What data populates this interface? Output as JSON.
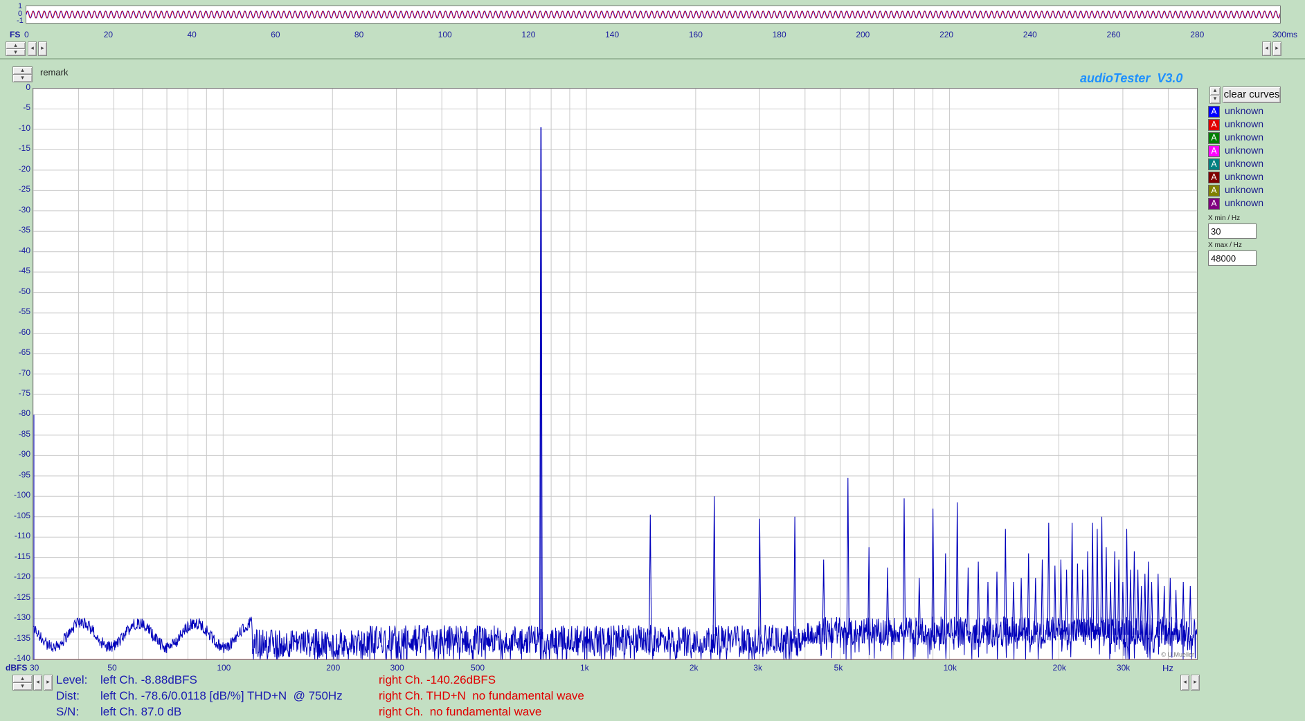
{
  "app": {
    "title": "audioTester  V3.0",
    "copyright": "© U.Mueller",
    "remark_label": "remark"
  },
  "waveform": {
    "y_labels": [
      "1",
      "0",
      "-1"
    ],
    "fs_label": "FS",
    "x_ticks": [
      "0",
      "20",
      "40",
      "60",
      "80",
      "100",
      "120",
      "140",
      "160",
      "180",
      "200",
      "220",
      "240",
      "260",
      "280",
      "300ms"
    ],
    "x_range_ms": [
      0,
      300
    ],
    "line_colors": [
      "#0000ff",
      "#e00000"
    ]
  },
  "spectrum": {
    "y_unit": "dBFS",
    "x_unit": "Hz",
    "y_ticks": [
      "0",
      "-5",
      "-10",
      "-15",
      "-20",
      "-25",
      "-30",
      "-35",
      "-40",
      "-45",
      "-50",
      "-55",
      "-60",
      "-65",
      "-70",
      "-75",
      "-80",
      "-85",
      "-90",
      "-95",
      "-100",
      "-105",
      "-110",
      "-115",
      "-120",
      "-125",
      "-130",
      "-135",
      "-140"
    ],
    "x_tick_labels": [
      {
        "f": 30,
        "t": "30"
      },
      {
        "f": 50,
        "t": "50"
      },
      {
        "f": 100,
        "t": "100"
      },
      {
        "f": 200,
        "t": "200"
      },
      {
        "f": 300,
        "t": "300"
      },
      {
        "f": 500,
        "t": "500"
      },
      {
        "f": 1000,
        "t": "1k"
      },
      {
        "f": 2000,
        "t": "2k"
      },
      {
        "f": 3000,
        "t": "3k"
      },
      {
        "f": 5000,
        "t": "5k"
      },
      {
        "f": 10000,
        "t": "10k"
      },
      {
        "f": 20000,
        "t": "20k"
      },
      {
        "f": 30000,
        "t": "30k"
      }
    ],
    "colors": {
      "left": "#0000bb",
      "right": "#e00000",
      "grid": "#c8c8c8"
    }
  },
  "chart_data": {
    "type": "line",
    "xscale": "log",
    "xlim": [
      30,
      48000
    ],
    "ylim": [
      -140,
      0
    ],
    "xlabel": "Hz",
    "ylabel": "dBFS",
    "series": [
      {
        "name": "left Ch.",
        "color": "#0000bb",
        "peaks": [
          {
            "x": 750,
            "y": -9.5
          },
          {
            "x": 1500,
            "y": -104.5
          },
          {
            "x": 2250,
            "y": -100
          },
          {
            "x": 3000,
            "y": -105.5
          },
          {
            "x": 3750,
            "y": -105
          },
          {
            "x": 4500,
            "y": -115.5
          },
          {
            "x": 5250,
            "y": -95.5
          },
          {
            "x": 6000,
            "y": -112.5
          },
          {
            "x": 6750,
            "y": -117.5
          },
          {
            "x": 7500,
            "y": -100.5
          },
          {
            "x": 8250,
            "y": -120
          },
          {
            "x": 9000,
            "y": -103
          },
          {
            "x": 9750,
            "y": -114
          },
          {
            "x": 10500,
            "y": -101.5
          },
          {
            "x": 11250,
            "y": -117.5
          },
          {
            "x": 12000,
            "y": -116
          },
          {
            "x": 12750,
            "y": -121
          },
          {
            "x": 13500,
            "y": -118.5
          },
          {
            "x": 14250,
            "y": -108
          },
          {
            "x": 15000,
            "y": -121
          },
          {
            "x": 15750,
            "y": -120
          },
          {
            "x": 16500,
            "y": -114
          },
          {
            "x": 17250,
            "y": -120
          },
          {
            "x": 18000,
            "y": -115.5
          },
          {
            "x": 18750,
            "y": -106.5
          },
          {
            "x": 19500,
            "y": -117
          },
          {
            "x": 20250,
            "y": -115.5
          },
          {
            "x": 21000,
            "y": -118
          },
          {
            "x": 21750,
            "y": -106.5
          },
          {
            "x": 22500,
            "y": -116.5
          },
          {
            "x": 23250,
            "y": -118
          },
          {
            "x": 24000,
            "y": -113.5
          },
          {
            "x": 24750,
            "y": -106.5
          },
          {
            "x": 25500,
            "y": -108
          },
          {
            "x": 26250,
            "y": -105
          },
          {
            "x": 27000,
            "y": -112.5
          },
          {
            "x": 27750,
            "y": -121
          },
          {
            "x": 28500,
            "y": -113.5
          },
          {
            "x": 29250,
            "y": -115.5
          },
          {
            "x": 30000,
            "y": -121
          },
          {
            "x": 30750,
            "y": -108
          },
          {
            "x": 31500,
            "y": -118
          },
          {
            "x": 32250,
            "y": -113.5
          },
          {
            "x": 33000,
            "y": -118
          },
          {
            "x": 33750,
            "y": -122
          },
          {
            "x": 34500,
            "y": -119
          },
          {
            "x": 35250,
            "y": -116
          },
          {
            "x": 36000,
            "y": -121
          },
          {
            "x": 37500,
            "y": -119
          },
          {
            "x": 39000,
            "y": -122
          },
          {
            "x": 40500,
            "y": -120
          },
          {
            "x": 42000,
            "y": -123
          },
          {
            "x": 44000,
            "y": -121
          },
          {
            "x": 46000,
            "y": -122
          }
        ],
        "noise_floor_dBFS": -135
      },
      {
        "name": "right Ch.",
        "color": "#e00000",
        "level_dBFS": -140.26
      }
    ]
  },
  "legend": {
    "clear_button": "clear curves",
    "items": [
      {
        "letter": "A",
        "label": "unknown",
        "color": "#0000ff"
      },
      {
        "letter": "A",
        "label": "unknown",
        "color": "#e00000"
      },
      {
        "letter": "A",
        "label": "unknown",
        "color": "#008000"
      },
      {
        "letter": "A",
        "label": "unknown",
        "color": "#ff00ff"
      },
      {
        "letter": "A",
        "label": "unknown",
        "color": "#008080"
      },
      {
        "letter": "A",
        "label": "unknown",
        "color": "#800000"
      },
      {
        "letter": "A",
        "label": "unknown",
        "color": "#808000"
      },
      {
        "letter": "A",
        "label": "unknown",
        "color": "#800080"
      }
    ],
    "xmin_label": "X min / Hz",
    "xmin_value": "30",
    "xmax_label": "X max / Hz",
    "xmax_value": "48000"
  },
  "status": {
    "level": {
      "key": "Level:",
      "left": "left Ch. -8.88dBFS",
      "right": "right Ch. -140.26dBFS"
    },
    "dist": {
      "key": "Dist:",
      "left": "left Ch. -78.6/0.0118 [dB/%] THD+N  @ 750Hz",
      "right": "right Ch. THD+N  no fundamental wave"
    },
    "sn": {
      "key": "S/N:",
      "left": "left Ch. 87.0 dB",
      "right": "right Ch.  no fundamental wave"
    }
  }
}
